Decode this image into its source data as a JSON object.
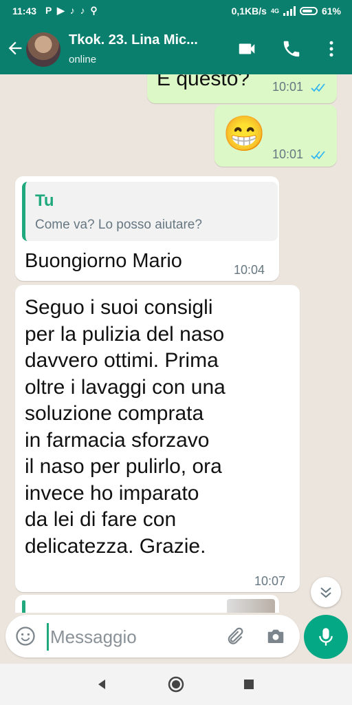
{
  "status_bar": {
    "time": "11:43",
    "notification_icons": [
      "signal-p-icon",
      "play-icon",
      "tiktok-icon",
      "tiktok-icon",
      "keyhole-icon"
    ],
    "notification_glyphs": "P ▶ ♪ ♪ ⚲",
    "speed": "0,1KB/s",
    "network": "4G",
    "battery": "61%"
  },
  "header": {
    "contact_name": "Tkok. 23. Lina Mic...",
    "status": "online",
    "actions": [
      "video-call-icon",
      "phone-icon",
      "more-icon"
    ]
  },
  "messages": [
    {
      "direction": "outgoing",
      "text": "E questo?",
      "time": "10:01",
      "read": true
    },
    {
      "direction": "outgoing",
      "text": "😁",
      "time": "10:01",
      "read": true
    },
    {
      "direction": "incoming",
      "reply_to": {
        "sender": "Tu",
        "text": "Come va? Lo posso aiutare?"
      },
      "text": "Buongiorno Mario",
      "time": "10:04"
    },
    {
      "direction": "incoming",
      "lines": [
        "Seguo i suoi consigli",
        "per la pulizia del naso",
        "davvero ottimi. Prima",
        "oltre i lavaggi con una",
        "soluzione comprata",
        "in farmacia sforzavo",
        "il naso per pulirlo, ora",
        "invece ho imparato",
        "da lei di fare con",
        "delicatezza. Grazie."
      ],
      "time": "10:07"
    }
  ],
  "composer": {
    "placeholder": "Messaggio"
  },
  "colors": {
    "header": "#0a7f6e",
    "accent": "#1fa97d",
    "outgoing": "#dcf8c6",
    "incoming": "#ffffff",
    "read_tick": "#34b7f1",
    "mic": "#05a884"
  }
}
